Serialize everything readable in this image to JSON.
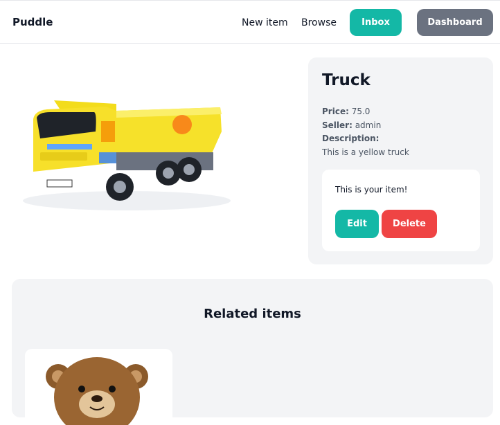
{
  "navbar": {
    "brand": "Puddle",
    "links": {
      "new_item": "New item",
      "browse": "Browse"
    },
    "inbox_label": "Inbox",
    "dashboard_label": "Dashboard"
  },
  "item": {
    "name": "Truck",
    "price_label": "Price:",
    "price": "75.0",
    "seller_label": "Seller:",
    "seller": "admin",
    "description_label": "Description:",
    "description": "This is a yellow truck",
    "owner_notice": "This is your item!",
    "edit_label": "Edit",
    "delete_label": "Delete"
  },
  "related": {
    "title": "Related items"
  },
  "colors": {
    "teal": "#14b8a6",
    "gray_button": "#6b7280",
    "red": "#ef4444",
    "panel": "#f3f4f6"
  }
}
